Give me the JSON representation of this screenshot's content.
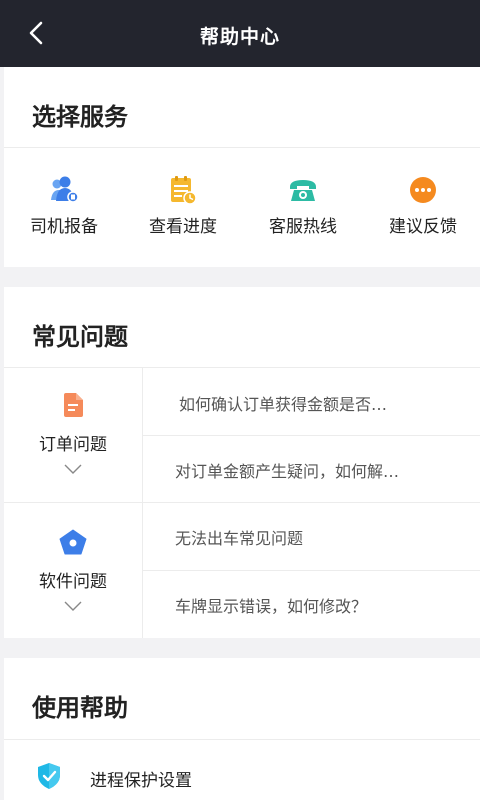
{
  "header": {
    "title": "帮助中心"
  },
  "services": {
    "title": "选择服务",
    "items": [
      {
        "label": "司机报备",
        "icon": "driver-report-icon",
        "color": "#3d7ee8"
      },
      {
        "label": "查看进度",
        "icon": "progress-note-icon",
        "color": "#f5b82e"
      },
      {
        "label": "客服热线",
        "icon": "phone-icon",
        "color": "#2dbba4"
      },
      {
        "label": "建议反馈",
        "icon": "more-dots-icon",
        "color": "#f58a1f"
      }
    ]
  },
  "faq": {
    "title": "常见问题",
    "categories": [
      {
        "label": "订单问题",
        "icon": "document-icon",
        "questions": [
          "如何确认订单获得金额是否…",
          "对订单金额产生疑问，如何解…"
        ]
      },
      {
        "label": "软件问题",
        "icon": "pentagon-icon",
        "questions": [
          "无法出车常见问题",
          "车牌显示错误，如何修改？"
        ]
      }
    ]
  },
  "usage": {
    "title": "使用帮助",
    "items": [
      {
        "label": "进程保护设置",
        "icon": "shield-check-icon"
      }
    ]
  }
}
